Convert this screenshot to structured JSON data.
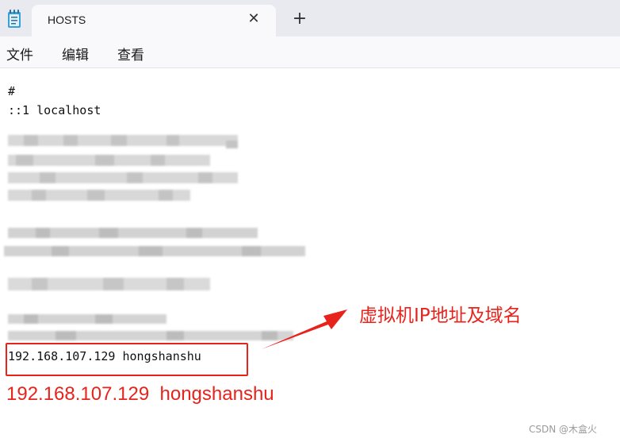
{
  "window": {
    "tab_title": "HOSTS",
    "tab_close_glyph": "✕",
    "new_tab_glyph": "+",
    "app_icon": "notepad-icon"
  },
  "menu": {
    "items": [
      "文件",
      "编辑",
      "查看"
    ]
  },
  "editor": {
    "lines": {
      "comment": "#",
      "localhost": "::1 localhost",
      "entry": "192.168.107.129 hongshanshu"
    }
  },
  "annotation": {
    "label": "虚拟机IP地址及域名",
    "text": "192.168.107.129  hongshanshu",
    "color": "#e8231c"
  },
  "watermark": "CSDN @木盒火"
}
